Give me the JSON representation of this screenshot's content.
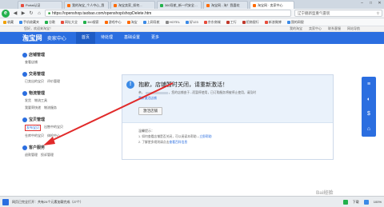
{
  "browser": {
    "tabs": [
      {
        "label": "Portal认证",
        "color": "#e74c3c"
      },
      {
        "label": "我的淘宝_个人中心_我",
        "color": "#ff6a00"
      },
      {
        "label": "淘宝卖家_如何...",
        "color": "#ff6a00"
      },
      {
        "label": "360导航_新一代安全上网",
        "color": "#22b14c"
      },
      {
        "label": "淘宝网 - 淘！我喜欢",
        "color": "#ff6a00"
      },
      {
        "label": "淘宝网 · 卖家中心",
        "color": "#ff6a00",
        "active": true
      }
    ],
    "url": "https://openshop.taobao.com/openshop/shopDelete.htm",
    "search_placeholder": "辽宁舰新型重气雷装",
    "bookmarks": [
      "收藏",
      "手机收藏夹",
      "谷歌",
      "网址大全",
      "360搜索",
      "游戏中心",
      "淘宝",
      "上网导航",
      "HOTEL",
      "好123",
      "京东商城",
      "工行",
      "招商银行",
      "新浪微博",
      "我的网银"
    ]
  },
  "seller": {
    "top_left": "您好，欢迎来淘宝！",
    "top_right": [
      "我的淘宝",
      "卖家中心",
      "联系客服",
      "网站导航"
    ],
    "logo": "淘宝网",
    "logo_sub": "taobao.com",
    "title": "卖家中心",
    "nav": [
      "首页",
      "待处理",
      "基础设置",
      "更多"
    ]
  },
  "sidebar": [
    {
      "title": "店铺管理",
      "items": [
        "查看店铺"
      ]
    },
    {
      "title": "交易管理",
      "items": [
        "已卖出的宝贝",
        "评价管理"
      ]
    },
    {
      "title": "物流管理",
      "items": [
        "发货",
        "物流工具",
        "我要寄快递",
        "物流服务"
      ]
    },
    {
      "title": "宝贝管理",
      "items": [
        "发布宝贝",
        "出售中的宝贝",
        "仓库中的宝贝",
        "体检中心"
      ]
    },
    {
      "title": "客户服务",
      "items": [
        "退款管理",
        "投诉管理"
      ]
    }
  ],
  "panel": {
    "alert_icon": "!",
    "title": "抱歉，店铺暂时关闭，请重新激活！",
    "line1_a": "亲，",
    "line1_b": "，您的店铺由于...而暂停使用，已订购服务将被停止使用，请及时",
    "line2": "重新激活店铺",
    "activate_label": "激活店铺",
    "tips_header": "温馨提示：",
    "tip1_text": "1. 如何查看店铺是否关闭，可以阅读本帮助→",
    "tip1_link": "立即帮助",
    "tip2_text": "2. 了解更多规则请点击",
    "tip2_link": "查看百科信息"
  },
  "right_toolbar": [
    "≡",
    "◐",
    "$",
    "⌂"
  ],
  "taskbar": {
    "status": "网页已完全打开：共有24个元素加载完成（27个）",
    "items": [
      "下载",
      "100%"
    ],
    "watermark": "Bai经验"
  }
}
